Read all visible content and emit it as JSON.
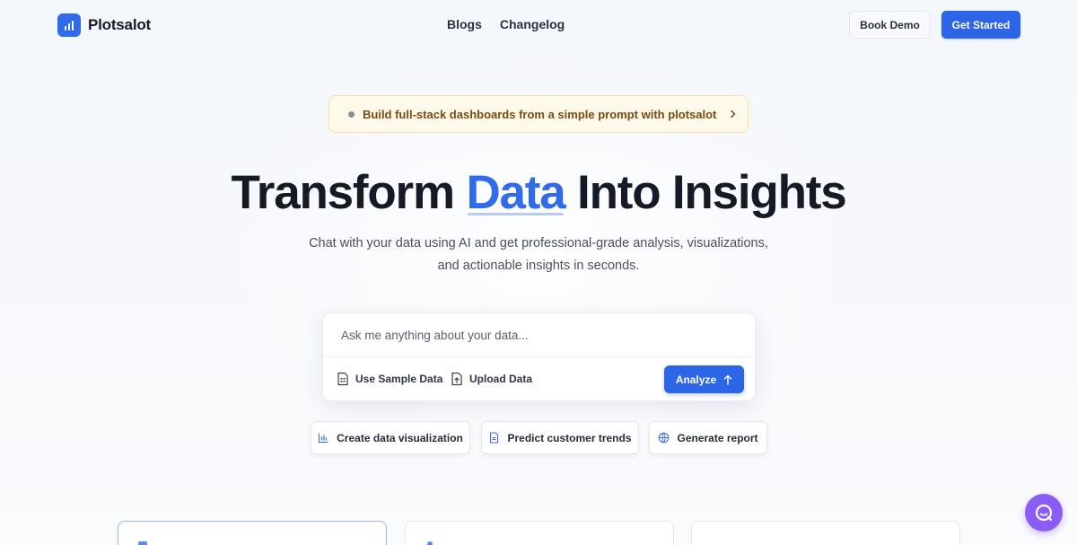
{
  "brand": {
    "name": "Plotsalot",
    "color": "#2f6bea"
  },
  "nav": {
    "links": [
      {
        "label": "Blogs"
      },
      {
        "label": "Changelog"
      }
    ],
    "book_demo": "Book Demo",
    "get_started": "Get Started"
  },
  "announcement": {
    "text": "Build full-stack dashboards from a simple prompt with plotsalot",
    "icon": "chevron-right-icon"
  },
  "hero": {
    "title_pre": "Transform ",
    "title_highlight": "Data",
    "title_post": " Into Insights",
    "subtitle_line1": "Chat with your data using AI and get professional-grade analysis, visualizations,",
    "subtitle_line2": "and actionable insights in seconds."
  },
  "search": {
    "placeholder": "Ask me anything about your data...",
    "sample_label": "Use Sample Data",
    "upload_label": "Upload Data",
    "analyze_label": "Analyze"
  },
  "suggestions": [
    {
      "label": "Create data visualization",
      "icon": "bar-chart-icon"
    },
    {
      "label": "Predict customer trends",
      "icon": "document-icon"
    },
    {
      "label": "Generate report",
      "icon": "globe-icon"
    }
  ],
  "colors": {
    "accent": "#2c66e6",
    "announce_bg": "#fef9e8",
    "announce_text": "#7a4a12",
    "chat": "#8b5cf6"
  }
}
